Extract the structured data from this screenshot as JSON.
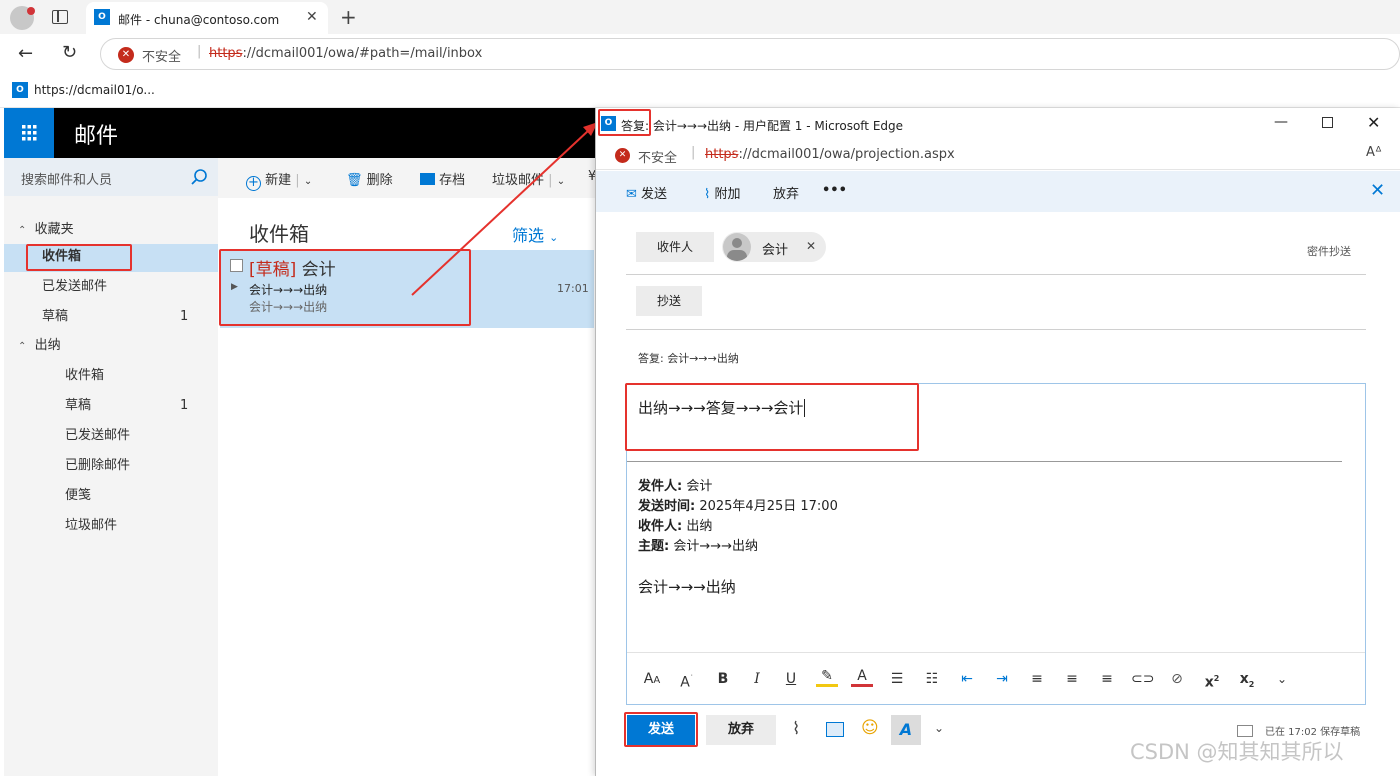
{
  "browser": {
    "tab_title": "邮件 - chuna@contoso.com",
    "insecure_label": "不安全",
    "url_scheme": "https",
    "url_rest": "://dcmail001/owa/#path=/mail/inbox",
    "favorite": "https://dcmail01/o..."
  },
  "owa": {
    "app_title": "邮件",
    "search_placeholder": "搜索邮件和人员",
    "toolbar": {
      "new": "新建",
      "delete": "删除",
      "archive": "存档",
      "junk": "垃圾邮件",
      "more": "¥"
    },
    "nav": {
      "favorites": "收藏夹",
      "inbox": "收件箱",
      "sent": "已发送邮件",
      "drafts": "草稿",
      "drafts_count": "1",
      "account": "出纳",
      "sub": [
        "收件箱",
        "草稿",
        "已发送邮件",
        "已删除邮件",
        "便笺",
        "垃圾邮件"
      ],
      "sub_drafts_count": "1"
    },
    "list": {
      "title": "收件箱",
      "filter": "筛选",
      "item": {
        "tag": "[草稿]",
        "sender": "会计",
        "subject": "会计→→→出纳",
        "preview": "会计→→→出纳",
        "time": "17:01"
      }
    }
  },
  "popup": {
    "title_prefix": "答复: ",
    "title_rest": "会计→→→出纳 - 用户配置 1 - Microsoft Edge",
    "insecure_label": "不安全",
    "url_scheme": "https",
    "url_rest": "://dcmail001/owa/projection.aspx",
    "toolbar": {
      "send": "发送",
      "attach": "附加",
      "discard": "放弃",
      "more": "•••"
    },
    "to_label": "收件人",
    "recipient": "会计",
    "bcc_link": "密件抄送",
    "cc_label": "抄送",
    "subject": "答复: 会计→→→出纳",
    "body_text": "出纳→→→答复→→→会计",
    "quote": {
      "from_label": "发件人:",
      "from": "会计",
      "sent_label": "发送时间:",
      "sent": "2025年4月25日 17:00",
      "to_label": "收件人:",
      "to": "出纳",
      "subject_label": "主题:",
      "subject": "会计→→→出纳",
      "body": "会计→→→出纳"
    },
    "send_button": "发送",
    "discard_button": "放弃",
    "saved_status": "已在 17:02 保存草稿"
  },
  "watermark": "CSDN @知其知其所以",
  "colors": {
    "accent": "#0078d4",
    "annotation_red": "#e5322d",
    "selected": "#c7e0f4"
  }
}
